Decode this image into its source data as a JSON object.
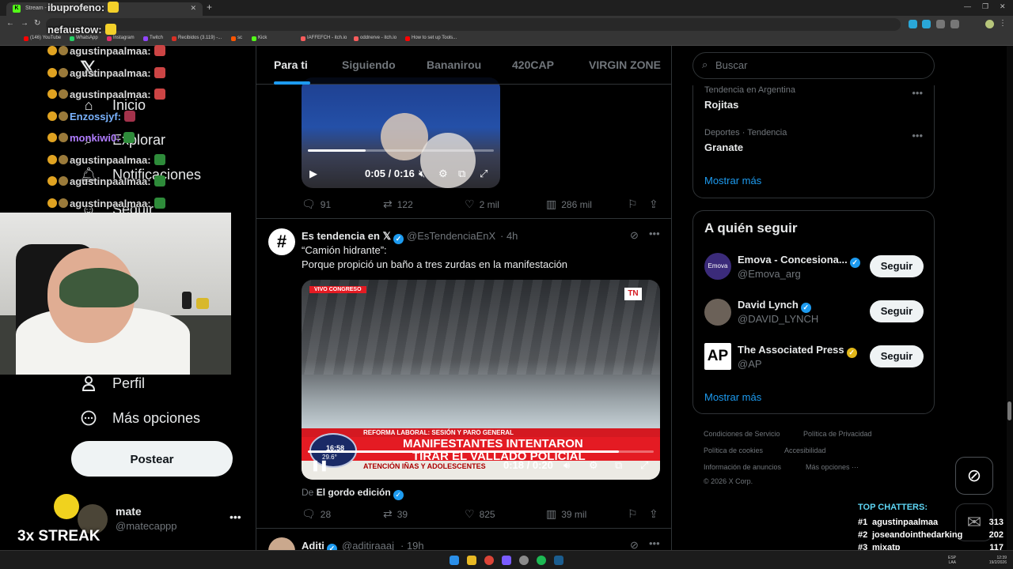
{
  "browser": {
    "tab_title": "Stream - KICK Dashboard",
    "bookmarks": [
      "(146) YouTube",
      "WhatsApp",
      "Instagram",
      "Twitch",
      "Recibidos (3.119) -...",
      "sc",
      "Kick",
      "IAFFEFCH - itch.io",
      "oddnerve - itch.io",
      "How to set up Tools..."
    ]
  },
  "nav": {
    "logo": "𝕏",
    "items": [
      {
        "icon": "home-icon",
        "label": "Inicio"
      },
      {
        "icon": "search-icon",
        "label": "Explorar"
      },
      {
        "icon": "bell-icon",
        "label": "Notificaciones"
      },
      {
        "icon": "people-icon",
        "label": "Seguir"
      },
      {
        "icon": "person-icon",
        "label": "Perfil"
      },
      {
        "icon": "more-circle-icon",
        "label": "Más opciones"
      }
    ],
    "post_button": "Postear",
    "account": {
      "name": "mate",
      "handle": "@matecappp",
      "more": "•••"
    }
  },
  "feed": {
    "tabs": [
      "Para ti",
      "Siguiendo",
      "Bananirou",
      "420CAP",
      "VIRGIN ZONE"
    ],
    "active_tab": "Para ti",
    "tweet1": {
      "video_time": "0:05 / 0:16",
      "video_progress": 0.31,
      "stats": {
        "replies": "91",
        "reposts": "122",
        "likes": "2 mil",
        "views": "286 mil"
      }
    },
    "tweet2": {
      "name": "Es tendencia en 𝕏",
      "handle": "@EsTendenciaEnX",
      "time": "· 4h",
      "line1": "“Camión hidrante”:",
      "line2": "Porque propició un baño a tres zurdas en la manifestación",
      "video": {
        "live": "VIVO",
        "source": "CONGRESO",
        "network": "TN",
        "band": "REFORMA LABORAL: SESIÓN Y PARO GENERAL",
        "headline1": "MANIFESTANTES INTENTARON",
        "headline2": "TIRAR EL VALLADO POLICIAL",
        "ticker": "ATENCIÓN    IÑAS Y ADOLESCENTES",
        "clock": "16:58",
        "temp": "29.6°",
        "time": "0:18 / 0:20",
        "progress": 0.9
      },
      "attribution_prefix": "De",
      "attribution_name": "El gordo edición",
      "stats": {
        "replies": "28",
        "reposts": "39",
        "likes": "825",
        "views": "39 mil"
      }
    },
    "tweet3": {
      "name": "Aditi",
      "handle": "@aditiraaaj",
      "time": "· 19h"
    }
  },
  "sidebar": {
    "search_placeholder": "Buscar",
    "trends": [
      {
        "category": "Tendencia en Argentina",
        "name": "Rojitas"
      },
      {
        "category": "Deportes · Tendencia",
        "name": "Granate"
      }
    ],
    "trends_more": "Mostrar más",
    "follow_title": "A quién seguir",
    "follow": [
      {
        "name": "Emova - Concesiona...",
        "handle": "@Emova_arg",
        "button": "Seguir",
        "badge": "blue"
      },
      {
        "name": "David Lynch",
        "handle": "@DAVID_LYNCH",
        "button": "Seguir",
        "badge": "blue"
      },
      {
        "name": "The Associated Press",
        "handle": "@AP",
        "button": "Seguir",
        "badge": "gold"
      }
    ],
    "follow_more": "Mostrar más",
    "footer": [
      "Condiciones de Servicio",
      "Política de Privacidad",
      "Política de cookies",
      "Accesibilidad",
      "Información de anuncios",
      "Más opciones ···",
      "© 2026 X Corp."
    ]
  },
  "stream": {
    "chat": [
      {
        "user": "ibuprofeno:",
        "color": "#e8e8e8"
      },
      {
        "user": "nefaustow:",
        "color": "#e8e8e8"
      },
      {
        "user": "agustinpaalmaa:",
        "color": "#d8d8d8"
      },
      {
        "user": "agustinpaalmaa:",
        "color": "#d8d8d8"
      },
      {
        "user": "agustinpaalmaa:",
        "color": "#d8d8d8"
      },
      {
        "user": "Enzossjyf:",
        "color": "#7ab3ff"
      },
      {
        "user": "monkiwi0:",
        "color": "#b07cff"
      },
      {
        "user": "agustinpaalmaa:",
        "color": "#d8d8d8"
      },
      {
        "user": "agustinpaalmaa:",
        "color": "#d8d8d8"
      },
      {
        "user": "agustinpaalmaa:",
        "color": "#d8d8d8"
      }
    ],
    "streak": "3x STREAK",
    "top_chatters_title": "TOP CHATTERS:",
    "top_chatters": [
      {
        "rank": "#1",
        "name": "agustinpaalmaa",
        "count": "313"
      },
      {
        "rank": "#2",
        "name": "joseandointhedarking",
        "count": "202"
      },
      {
        "rank": "#3",
        "name": "mixatp",
        "count": "117"
      }
    ]
  },
  "taskbar": {
    "lang": "ESP LAA",
    "time": "12:39",
    "date": "19/2/2026"
  }
}
